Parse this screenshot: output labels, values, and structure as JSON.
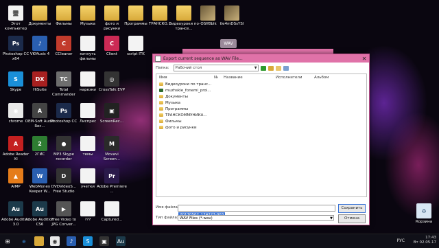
{
  "desktop": {
    "row1": [
      {
        "label": "Этот компьютер",
        "type": "doc",
        "glyph": "🖥"
      },
      {
        "label": "Документы",
        "type": "folder"
      },
      {
        "label": "Фильмы",
        "type": "folder"
      },
      {
        "label": "Музыка",
        "type": "folder"
      },
      {
        "label": "фото и рисунки",
        "type": "folder"
      },
      {
        "label": "Программы",
        "type": "folder"
      },
      {
        "label": "ТРАНСКО...",
        "type": "folder"
      },
      {
        "label": "Видеоуроки по трансе...",
        "type": "folder"
      },
      {
        "label": "-OSff8blk",
        "type": "img"
      },
      {
        "label": "tle4mDSsYSI",
        "type": "img"
      }
    ],
    "row2": [
      {
        "label": "Photoshop CC x64",
        "color": "#1b2a4a",
        "glyph": "Ps"
      },
      {
        "label": "VKMusic 4",
        "color": "#2a5fb0",
        "glyph": "♪"
      },
      {
        "label": "CCleaner",
        "color": "#c23b2c",
        "glyph": "C"
      },
      {
        "label": "качнуть фильмы",
        "type": "doc"
      },
      {
        "label": "Client",
        "color": "#cc2a55",
        "glyph": "C"
      },
      {
        "label": "script ITK",
        "type": "doc"
      }
    ],
    "row3": [
      {
        "label": "Skype",
        "color": "#1a8fd8",
        "glyph": "S"
      },
      {
        "label": "HiSuite",
        "color": "#a72020",
        "glyph": "DX"
      },
      {
        "label": "Total Commander",
        "color": "#6e6e6e",
        "glyph": "TC"
      },
      {
        "label": "нарезки",
        "type": "doc"
      },
      {
        "label": "CrossTalk EVP",
        "color": "#333",
        "glyph": "◎"
      }
    ],
    "row4": [
      {
        "label": "chrome",
        "color": "#e8e8e8",
        "glyph": "◉"
      },
      {
        "label": "ОЕМ-Soft Audio Rec...",
        "color": "#444",
        "glyph": "A"
      },
      {
        "label": "Photoshop CC",
        "color": "#1b2a4a",
        "glyph": "Ps"
      },
      {
        "label": "Лиспрес",
        "type": "doc"
      },
      {
        "label": "ScreenRec...",
        "color": "#222",
        "glyph": "▣"
      }
    ],
    "row5": [
      {
        "label": "Adobe Reader XI",
        "color": "#c42020",
        "glyph": "A"
      },
      {
        "label": "2ГИС",
        "color": "#2e7d32",
        "glyph": "2"
      },
      {
        "label": "MP3 Skype recorder",
        "color": "#333",
        "glyph": "●"
      },
      {
        "label": "темы",
        "type": "doc"
      },
      {
        "label": "Movavi Screen...",
        "color": "#2a2a2a",
        "glyph": "M"
      }
    ],
    "row6": [
      {
        "label": "AIMP",
        "color": "#e57c1a",
        "glyph": "▲"
      },
      {
        "label": "WebMoney Keeper W...",
        "color": "#2a5fb0",
        "glyph": "W"
      },
      {
        "label": "DVDVideoS... Free Studio",
        "color": "#333",
        "glyph": "D"
      },
      {
        "label": "учетки",
        "type": "doc"
      },
      {
        "label": "Adobe Premiere ...",
        "color": "#2a1a4a",
        "glyph": "Pr"
      }
    ],
    "row7": [
      {
        "label": "Adobe Audition 3.0",
        "color": "#1c3a4a",
        "glyph": "Au"
      },
      {
        "label": "Adobe Audition CS6",
        "color": "#1c3a4a",
        "glyph": "Au"
      },
      {
        "label": "Free Video to JPG Conver...",
        "color": "#555",
        "glyph": "▶"
      },
      {
        "label": "???",
        "type": "doc"
      },
      {
        "label": "Captured...",
        "type": "doc"
      }
    ],
    "recycle": "Корзина",
    "wav_button": "WAV"
  },
  "dialog": {
    "title": "Export current sequence as WAV File...",
    "lookin_label": "Папка:",
    "lookin_value": "Рабочий стол",
    "columns": [
      "Имя",
      "№",
      "Название",
      "Исполнители",
      "Альбом"
    ],
    "files": [
      {
        "name": "Видеоуроки по транс...",
        "kind": "folder"
      },
      {
        "name": "muzhskie_fonemi_proi...",
        "kind": "file"
      },
      {
        "name": "Документы",
        "kind": "folder"
      },
      {
        "name": "Музыка",
        "kind": "folder"
      },
      {
        "name": "Программы",
        "kind": "folder"
      },
      {
        "name": "ТРАНСКОММУНИКА...",
        "kind": "folder"
      },
      {
        "name": "Фильмы",
        "kind": "folder"
      },
      {
        "name": "фото и рисунки",
        "kind": "folder"
      }
    ],
    "filename_label": "Имя файла:",
    "filename_value": "20170502_174227-003",
    "filetype_label": "Тип файла:",
    "filetype_value": "WAV Files (*.wav)",
    "save_label": "Сохранить",
    "cancel_label": "Отмена"
  },
  "taskbar": {
    "lang": "РУС",
    "time": "17:43",
    "date": "Вт 02.05.17"
  }
}
